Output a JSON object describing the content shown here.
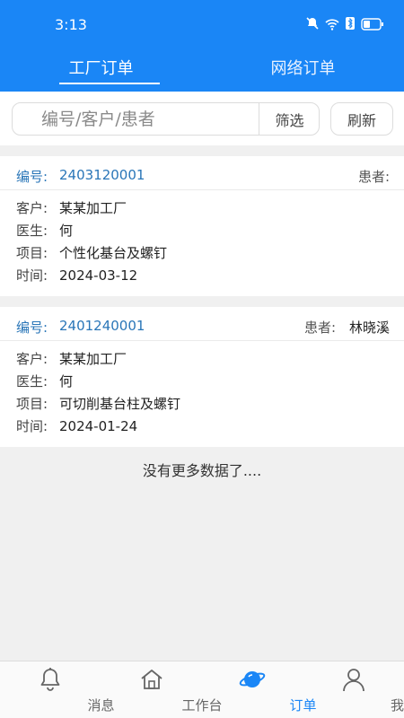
{
  "status_bar": {
    "time": "3:13"
  },
  "tabs": [
    {
      "label": "工厂订单",
      "active": true
    },
    {
      "label": "网络订单",
      "active": false
    }
  ],
  "search": {
    "placeholder": "编号/客户/患者",
    "filter_label": "筛选",
    "refresh_label": "刷新"
  },
  "orders": [
    {
      "code_label": "编号:",
      "code": "2403120001",
      "patient_label": "患者:",
      "patient": "",
      "customer_label": "客户:",
      "customer": "某某加工厂",
      "doctor_label": "医生:",
      "doctor": "何",
      "item_label": "项目:",
      "item": "个性化基台及螺钉",
      "time_label": "时间:",
      "time": "2024-03-12"
    },
    {
      "code_label": "编号:",
      "code": "2401240001",
      "patient_label": "患者:",
      "patient": "林晓溪",
      "customer_label": "客户:",
      "customer": "某某加工厂",
      "doctor_label": "医生:",
      "doctor": "何",
      "item_label": "项目:",
      "item": "可切削基台柱及螺钉",
      "time_label": "时间:",
      "time": "2024-01-24"
    }
  ],
  "no_more_text": "没有更多数据了....",
  "bottom_nav": [
    {
      "label": "消息",
      "icon": "bell-icon",
      "active": false
    },
    {
      "label": "工作台",
      "icon": "home-icon",
      "active": false
    },
    {
      "label": "订单",
      "icon": "planet-icon",
      "active": true
    },
    {
      "label": "我的",
      "icon": "user-icon",
      "active": false
    }
  ],
  "colors": {
    "primary": "#1a86f6",
    "link": "#2a76b8"
  }
}
